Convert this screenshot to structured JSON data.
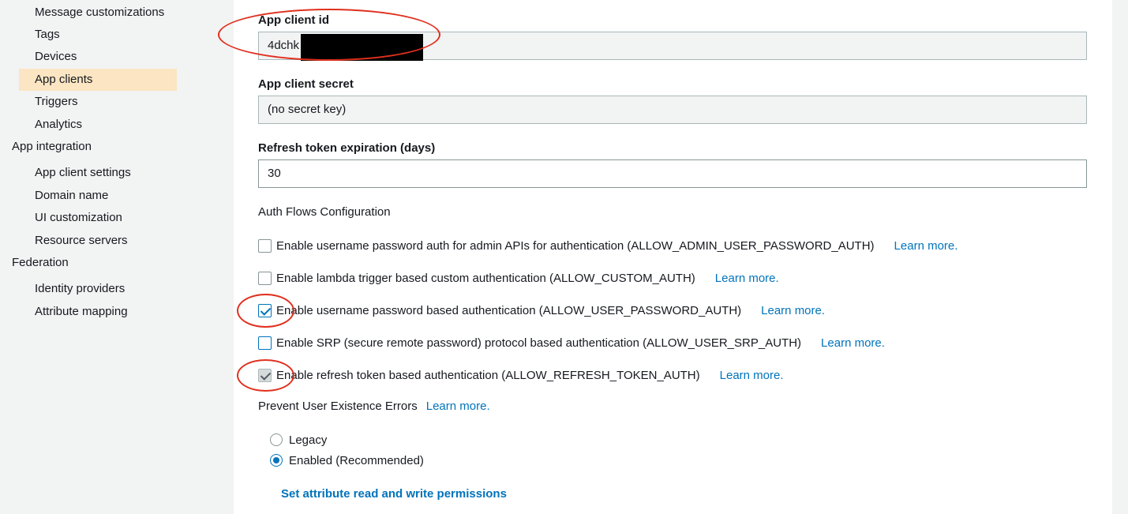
{
  "sidebar": {
    "items": [
      {
        "label": "Message customizations"
      },
      {
        "label": "Tags"
      },
      {
        "label": "Devices"
      },
      {
        "label": "App clients"
      },
      {
        "label": "Triggers"
      },
      {
        "label": "Analytics"
      }
    ],
    "groups": {
      "app_integration": {
        "label": "App integration",
        "items": [
          {
            "label": "App client settings"
          },
          {
            "label": "Domain name"
          },
          {
            "label": "UI customization"
          },
          {
            "label": "Resource servers"
          }
        ]
      },
      "federation": {
        "label": "Federation",
        "items": [
          {
            "label": "Identity providers"
          },
          {
            "label": "Attribute mapping"
          }
        ]
      }
    },
    "active_item": "App clients"
  },
  "form": {
    "client_id": {
      "label": "App client id",
      "value": "4dchk"
    },
    "client_secret": {
      "label": "App client secret",
      "value": "(no secret key)"
    },
    "refresh_token": {
      "label": "Refresh token expiration (days)",
      "value": "30"
    },
    "auth_flows": {
      "label": "Auth Flows Configuration",
      "options": [
        {
          "label": "Enable username password auth for admin APIs for authentication (ALLOW_ADMIN_USER_PASSWORD_AUTH)",
          "checked": false,
          "learn_more": "Learn more."
        },
        {
          "label": "Enable lambda trigger based custom authentication (ALLOW_CUSTOM_AUTH)",
          "checked": false,
          "learn_more": "Learn more."
        },
        {
          "label": "Enable username password based authentication (ALLOW_USER_PASSWORD_AUTH)",
          "checked": true,
          "learn_more": "Learn more."
        },
        {
          "label": "Enable SRP (secure remote password) protocol based authentication (ALLOW_USER_SRP_AUTH)",
          "checked": false,
          "learn_more": "Learn more."
        },
        {
          "label": "Enable refresh token based authentication (ALLOW_REFRESH_TOKEN_AUTH)",
          "checked": true,
          "disabled": true,
          "learn_more": "Learn more."
        }
      ]
    },
    "prevent_errors": {
      "label": "Prevent User Existence Errors",
      "learn_more": "Learn more.",
      "options": [
        {
          "label": "Legacy",
          "selected": false
        },
        {
          "label": "Enabled (Recommended)",
          "selected": true
        }
      ]
    },
    "permissions_link": "Set attribute read and write permissions"
  },
  "colors": {
    "accent": "#0073bb",
    "active_nav": "#fbe5c2",
    "annotation": "#e0301e"
  }
}
